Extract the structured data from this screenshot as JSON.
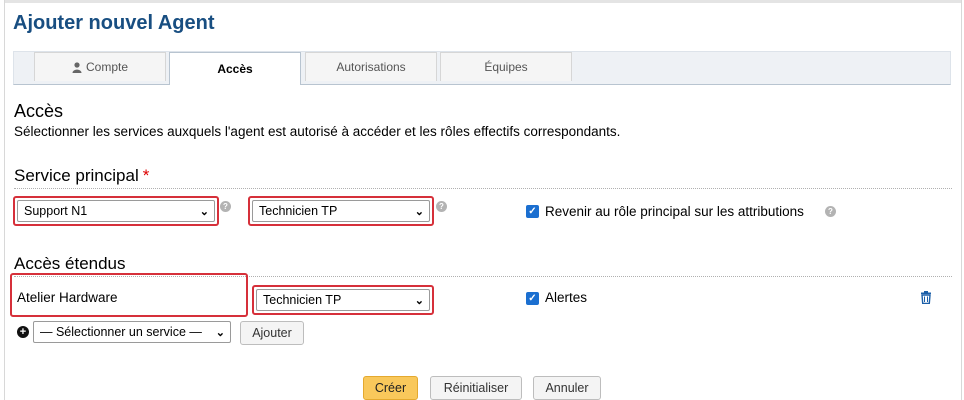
{
  "page": {
    "title": "Ajouter nouvel Agent"
  },
  "tabs": [
    {
      "label": "Compte",
      "icon": "user-icon"
    },
    {
      "label": "Accès",
      "active": true
    },
    {
      "label": "Autorisations"
    },
    {
      "label": "Équipes"
    }
  ],
  "access": {
    "heading": "Accès",
    "description": "Sélectionner les services auxquels l'agent est autorisé à accéder et les rôles effectifs correspondants."
  },
  "primary_service": {
    "heading": "Service principal",
    "required_mark": "*",
    "service_value": "Support N1",
    "role_value": "Technicien TP",
    "revert_label": "Revenir au rôle principal sur les attributions",
    "revert_checked": true
  },
  "extended": {
    "heading": "Accès étendus",
    "rows": [
      {
        "service": "Atelier Hardware",
        "role": "Technicien TP",
        "alerts_label": "Alertes",
        "alerts_checked": true
      }
    ],
    "add_select_value": "— Sélectionner un service —",
    "add_button": "Ajouter"
  },
  "actions": {
    "create": "Créer",
    "reset": "Réinitialiser",
    "cancel": "Annuler"
  },
  "colors": {
    "title": "#184e81",
    "highlight": "#d6303a",
    "checkbox": "#1b6fd0",
    "primary_button": "#f9c85b",
    "required": "#dd0000"
  },
  "icons": {
    "help": "help-icon",
    "delete": "trash-icon",
    "add": "plus-circle-icon",
    "dropdown": "chevron-down-icon",
    "checkbox": "check-icon"
  }
}
